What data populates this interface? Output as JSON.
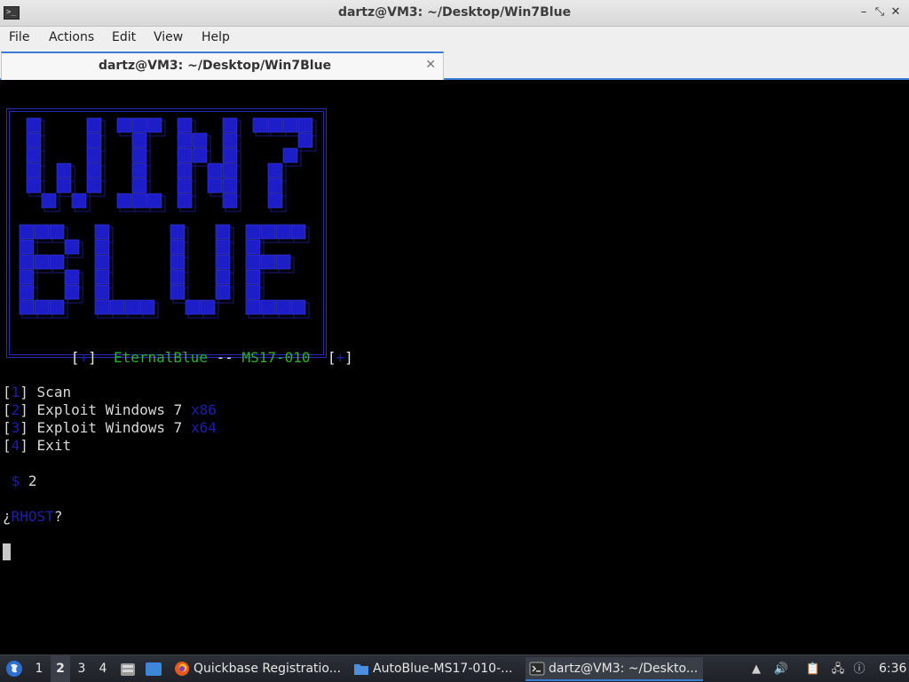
{
  "window": {
    "title": "dartz@VM3: ~/Desktop/Win7Blue",
    "controls": {
      "minimize": "–",
      "maximize": "⤡",
      "close": "✕"
    }
  },
  "menubar": {
    "file": "File",
    "actions": "Actions",
    "edit": "Edit",
    "view": "View",
    "help": "Help"
  },
  "tab": {
    "label": "dartz@VM3: ~/Desktop/Win7Blue",
    "close": "✕"
  },
  "terminal": {
    "banner_art_text": "WIN7 BLUE",
    "banner_footer": {
      "open1": "[",
      "plus1": "+",
      "close1": "]",
      "title": "EternalBlue",
      "sep": "--",
      "code": "MS17-010",
      "open2": "[",
      "plus2": "+",
      "close2": "]"
    },
    "menu": [
      {
        "num": "1",
        "label": "Scan",
        "arch": ""
      },
      {
        "num": "2",
        "label": "Exploit Windows 7",
        "arch": "x86"
      },
      {
        "num": "3",
        "label": "Exploit Windows 7",
        "arch": "x64"
      },
      {
        "num": "4",
        "label": "Exit",
        "arch": ""
      }
    ],
    "prompt_symbol": "$",
    "prompt_input": "2",
    "question_open": "¿",
    "question_word": "RHOST",
    "question_close": "?"
  },
  "taskbar": {
    "workspaces": [
      "1",
      "2",
      "3",
      "4"
    ],
    "active_workspace": "2",
    "tasks": [
      {
        "label": "Quickbase Registratio...",
        "icon": "firefox-icon"
      },
      {
        "label": "AutoBlue-MS17-010-...",
        "icon": "folder-icon"
      },
      {
        "label": "dartz@VM3: ~/Deskto...",
        "icon": "terminal-icon"
      }
    ],
    "clock": "6:36"
  },
  "colors": {
    "accent": "#3a7bd5",
    "terminal_bg": "#000000",
    "banner_blue": "#1e1ec8",
    "green": "#2fae2f"
  }
}
